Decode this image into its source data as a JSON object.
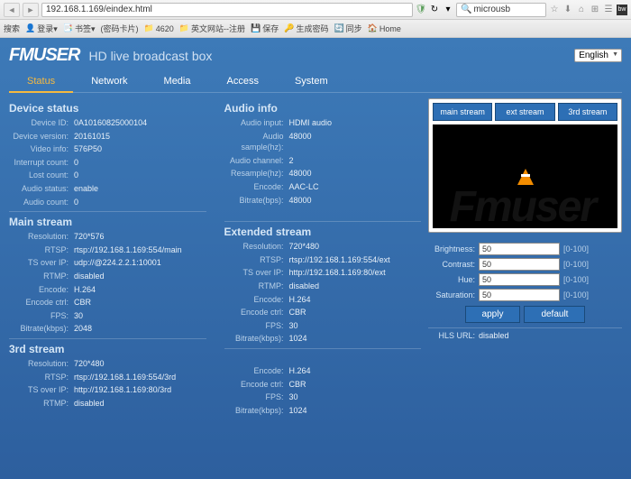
{
  "browser": {
    "url": "192.168.1.169/eindex.html",
    "search": "microusb",
    "bookmarks": [
      "搜索",
      "登录▾",
      "书签▾",
      "(密码卡片)",
      "4620",
      "英文网站--注册",
      "保存",
      "生成密码",
      "同步",
      "Home"
    ]
  },
  "header": {
    "logo": "FMUSER",
    "subtitle": "HD live broadcast box",
    "language": "English"
  },
  "tabs": [
    "Status",
    "Network",
    "Media",
    "Access",
    "System"
  ],
  "device_status": {
    "title": "Device status",
    "device_id": "0A10160825000104",
    "device_version": "20161015",
    "video_info": "576P50",
    "interrupt_count": "0",
    "lost_count": "0",
    "audio_status": "enable",
    "audio_count": "0"
  },
  "audio_info": {
    "title": "Audio info",
    "audio_input": "HDMI audio",
    "audio_sample": "48000",
    "audio_channel": "2",
    "resample": "48000",
    "encode": "AAC-LC",
    "bitrate": "48000"
  },
  "main_stream": {
    "title": "Main stream",
    "resolution": "720*576",
    "rtsp": "rtsp://192.168.1.169:554/main",
    "ts_over_ip": "udp://@224.2.2.1:10001",
    "rtmp": "disabled",
    "encode": "H.264",
    "encode_ctrl": "CBR",
    "fps": "30",
    "bitrate": "2048"
  },
  "extended_stream": {
    "title": "Extended stream",
    "resolution": "720*480",
    "rtsp": "rtsp://192.168.1.169:554/ext",
    "ts_over_ip": "http://192.168.1.169:80/ext",
    "rtmp": "disabled",
    "encode": "H.264",
    "encode_ctrl": "CBR",
    "fps": "30",
    "bitrate": "1024"
  },
  "third_stream": {
    "title": "3rd stream",
    "resolution": "720*480",
    "rtsp": "rtsp://192.168.1.169:554/3rd",
    "ts_over_ip": "http://192.168.1.169:80/3rd",
    "rtmp": "disabled",
    "encode": "H.264",
    "encode_ctrl": "CBR",
    "fps": "30",
    "bitrate": "1024"
  },
  "preview": {
    "tabs": [
      "main stream",
      "ext stream",
      "3rd stream"
    ]
  },
  "sliders": {
    "brightness": {
      "label": "Brightness:",
      "value": "50",
      "range": "[0-100]"
    },
    "contrast": {
      "label": "Contrast:",
      "value": "50",
      "range": "[0-100]"
    },
    "hue": {
      "label": "Hue:",
      "value": "50",
      "range": "[0-100]"
    },
    "saturation": {
      "label": "Saturation:",
      "value": "50",
      "range": "[0-100]"
    }
  },
  "buttons": {
    "apply": "apply",
    "default": "default"
  },
  "hls": {
    "label": "HLS URL:",
    "value": "disabled"
  },
  "labels": {
    "device_id": "Device ID:",
    "device_version": "Device version:",
    "video_info": "Video info:",
    "interrupt_count": "Interrupt count:",
    "lost_count": "Lost count:",
    "audio_status": "Audio status:",
    "audio_count": "Audio count:",
    "audio_input": "Audio input:",
    "audio_sample": "Audio sample(hz):",
    "audio_channel": "Audio channel:",
    "resample": "Resample(hz):",
    "encode": "Encode:",
    "bitrate_bps": "Bitrate(bps):",
    "resolution": "Resolution:",
    "rtsp": "RTSP:",
    "ts_over_ip": "TS over IP:",
    "rtmp": "RTMP:",
    "encode_ctrl": "Encode ctrl:",
    "fps": "FPS:",
    "bitrate_kbps": "Bitrate(kbps):"
  }
}
